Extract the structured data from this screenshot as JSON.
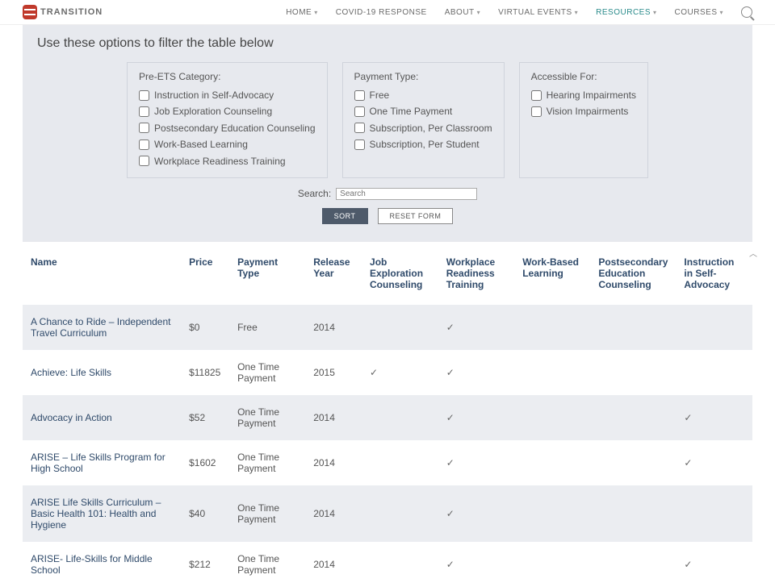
{
  "nav": {
    "brand": "Transition",
    "items": [
      {
        "label": "HOME",
        "dropdown": true
      },
      {
        "label": "COVID-19 RESPONSE",
        "dropdown": false
      },
      {
        "label": "ABOUT",
        "dropdown": true
      },
      {
        "label": "VIRTUAL EVENTS",
        "dropdown": true
      },
      {
        "label": "RESOURCES",
        "dropdown": true,
        "accent": true
      },
      {
        "label": "COURSES",
        "dropdown": true
      }
    ]
  },
  "filters": {
    "title": "Use these options to filter the table below",
    "groups": [
      {
        "title": "Pre-ETS Category:",
        "options": [
          "Instruction in Self-Advocacy",
          "Job Exploration Counseling",
          "Postsecondary Education Counseling",
          "Work-Based Learning",
          "Workplace Readiness Training"
        ]
      },
      {
        "title": "Payment Type:",
        "options": [
          "Free",
          "One Time Payment",
          "Subscription, Per Classroom",
          "Subscription, Per Student"
        ]
      },
      {
        "title": "Accessible For:",
        "options": [
          "Hearing Impairments",
          "Vision Impairments"
        ]
      }
    ],
    "search_label": "Search:",
    "search_placeholder": "Search",
    "sort_btn": "SORT",
    "reset_btn": "RESET FORM"
  },
  "table": {
    "headers": [
      "Name",
      "Price",
      "Payment Type",
      "Release Year",
      "Job Exploration Counseling",
      "Workplace Readiness Training",
      "Work-Based Learning",
      "Postsecondary Education Counseling",
      "Instruction in Self-Advocacy"
    ],
    "rows": [
      {
        "name": "A Chance to Ride – Independent Travel Curriculum",
        "price": "$0",
        "ptype": "Free",
        "year": "2014",
        "jec": "",
        "wrt": "✓",
        "wbl": "",
        "pec": "",
        "isa": ""
      },
      {
        "name": "Achieve: Life Skills",
        "price": "$11825",
        "ptype": "One Time Payment",
        "year": "2015",
        "jec": "✓",
        "wrt": "✓",
        "wbl": "",
        "pec": "",
        "isa": ""
      },
      {
        "name": "Advocacy in Action",
        "price": "$52",
        "ptype": "One Time Payment",
        "year": "2014",
        "jec": "",
        "wrt": "✓",
        "wbl": "",
        "pec": "",
        "isa": "✓"
      },
      {
        "name": "ARISE – Life Skills Program for High School",
        "price": "$1602",
        "ptype": "One Time Payment",
        "year": "2014",
        "jec": "",
        "wrt": "✓",
        "wbl": "",
        "pec": "",
        "isa": "✓"
      },
      {
        "name": "ARISE Life Skills Curriculum – Basic Health 101: Health and Hygiene",
        "price": "$40",
        "ptype": "One Time Payment",
        "year": "2014",
        "jec": "",
        "wrt": "✓",
        "wbl": "",
        "pec": "",
        "isa": ""
      },
      {
        "name": "ARISE- Life-Skills for Middle School",
        "price": "$212",
        "ptype": "One Time Payment",
        "year": "2014",
        "jec": "",
        "wrt": "✓",
        "wbl": "",
        "pec": "",
        "isa": "✓"
      }
    ]
  }
}
